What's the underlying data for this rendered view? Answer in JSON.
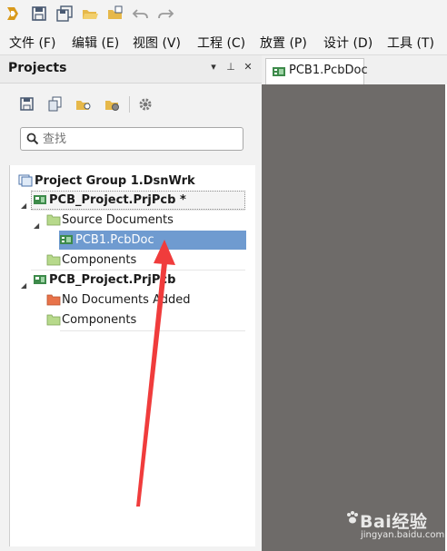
{
  "menubar": {
    "items": [
      "文件 (F)",
      "编辑 (E)",
      "视图 (V)",
      "工程 (C)",
      "放置 (P)",
      "设计 (D)",
      "工具 (T)"
    ]
  },
  "panel": {
    "title": "Projects",
    "header_buttons": [
      "▾",
      "⊥",
      "✕"
    ],
    "search": {
      "placeholder": "查找",
      "value": "查找"
    }
  },
  "tree": {
    "group": "Project Group 1.DsnWrk",
    "project1": "PCB_Project.PrjPcb *",
    "source_folder": "Source Documents",
    "pcb_doc": "PCB1.PcbDoc",
    "components1": "Components",
    "project2": "PCB_Project.PrjPcb",
    "no_docs": "No Documents Added",
    "components2": "Components"
  },
  "editor": {
    "tab_label": "PCB1.PcbDoc"
  },
  "watermark": {
    "logo_text": "Bai经验",
    "url": "jingyan.baidu.com"
  },
  "colors": {
    "selection": "#6f9bd0",
    "editor_bg": "#6e6b69",
    "arrow": "#f03c3c",
    "folder": "#b7d98b",
    "folder_red": "#e8734a"
  }
}
